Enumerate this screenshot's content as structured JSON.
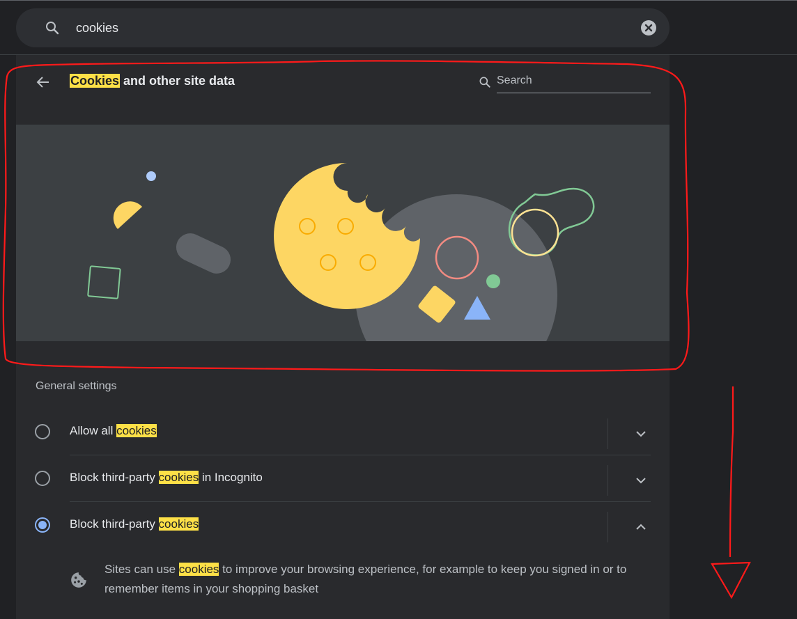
{
  "search": {
    "value": "cookies"
  },
  "header": {
    "title_highlight": "Cookies",
    "title_rest": " and other site data",
    "search_placeholder": "Search"
  },
  "general": {
    "title": "General settings",
    "options": [
      {
        "pre": "Allow all ",
        "hl": "cookies",
        "post": "",
        "selected": false,
        "expanded": false
      },
      {
        "pre": "Block third-party ",
        "hl": "cookies",
        "post": " in Incognito",
        "selected": false,
        "expanded": false
      },
      {
        "pre": "Block third-party ",
        "hl": "cookies",
        "post": "",
        "selected": true,
        "expanded": true
      }
    ],
    "description": {
      "pre": "Sites can use ",
      "hl": "cookies",
      "post": " to improve your browsing experience, for example to keep you signed in or to remember items in your shopping basket"
    }
  },
  "icons": {
    "search": "search-icon",
    "clear": "clear-icon",
    "back": "back-arrow-icon",
    "subpage_search": "search-icon",
    "chevron_down": "chevron-down-icon",
    "chevron_up": "chevron-up-icon",
    "cookie": "cookie-icon"
  },
  "colors": {
    "accent": "#8ab4f8",
    "highlight": "#fde047",
    "annotation": "#ff1a1a",
    "background": "#202124",
    "panel": "#292a2d"
  }
}
